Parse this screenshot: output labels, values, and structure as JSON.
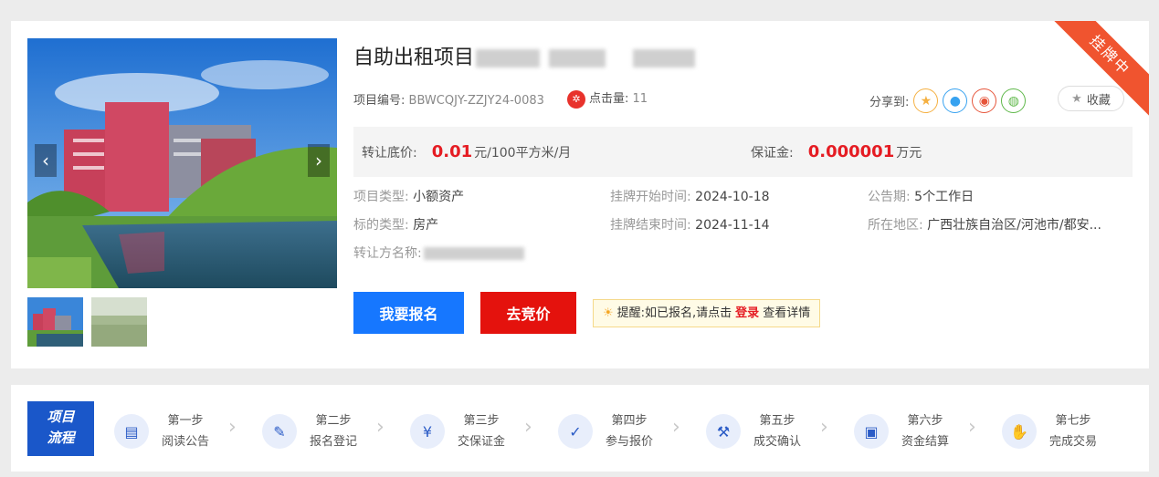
{
  "ribbon": "挂牌中",
  "title": "自助出租项目",
  "meta": {
    "code_label": "项目编号:",
    "code_value": "BBWCQJY-ZZJY24-0083",
    "clicks_label": "点击量:",
    "clicks_value": "11"
  },
  "share": {
    "label": "分享到:"
  },
  "favorite": {
    "label": "收藏"
  },
  "price": {
    "base_label": "转让底价:",
    "base_value": "0.01",
    "base_unit": "元/100平方米/月",
    "deposit_label": "保证金:",
    "deposit_value": "0.000001",
    "deposit_unit": "万元"
  },
  "info": {
    "project_type_label": "项目类型:",
    "project_type_value": "小额资产",
    "start_label": "挂牌开始时间:",
    "start_value": "2024-10-18",
    "period_label": "公告期:",
    "period_value": "5个工作日",
    "target_type_label": "标的类型:",
    "target_type_value": "房产",
    "end_label": "挂牌结束时间:",
    "end_value": "2024-11-14",
    "region_label": "所在地区:",
    "region_value": "广西壮族自治区/河池市/都安...",
    "transferor_label": "转让方名称:"
  },
  "buttons": {
    "signup": "我要报名",
    "bid": "去竞价"
  },
  "tip": {
    "prefix": "提醒:如已报名,请点击",
    "login": "登录",
    "suffix": "查看详情"
  },
  "flow": {
    "badge_line1": "项目",
    "badge_line2": "流程",
    "steps": [
      {
        "num": "第一步",
        "name": "阅读公告",
        "icon": "notice-icon"
      },
      {
        "num": "第二步",
        "name": "报名登记",
        "icon": "register-icon"
      },
      {
        "num": "第三步",
        "name": "交保证金",
        "icon": "deposit-icon"
      },
      {
        "num": "第四步",
        "name": "参与报价",
        "icon": "bid-icon"
      },
      {
        "num": "第五步",
        "name": "成交确认",
        "icon": "gavel-icon"
      },
      {
        "num": "第六步",
        "name": "资金结算",
        "icon": "settlement-icon"
      },
      {
        "num": "第七步",
        "name": "完成交易",
        "icon": "handshake-icon"
      }
    ]
  },
  "colors": {
    "accent": "#1677ff",
    "danger": "#e4120d",
    "ribbon": "#f0542f",
    "flow": "#1a57c9"
  }
}
